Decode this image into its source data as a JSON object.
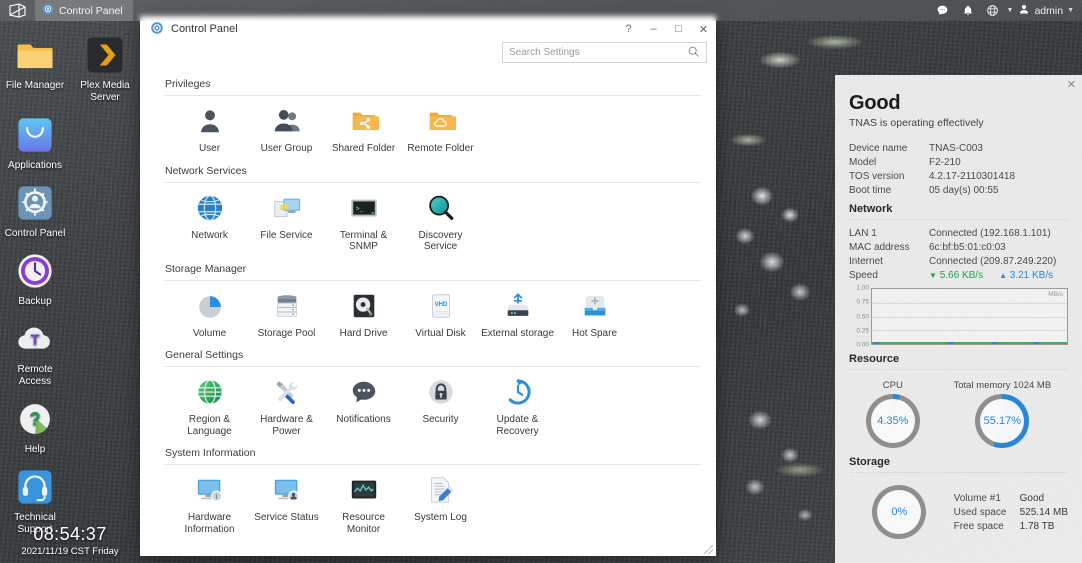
{
  "taskbar": {
    "home_icon": "tos-logo-icon",
    "task_label": "Control Panel",
    "task_icon": "control-panel-icon",
    "icons": [
      "chat-icon",
      "bell-icon",
      "globe-icon"
    ],
    "user_label": "admin",
    "user_icon": "user-icon"
  },
  "desktop": {
    "icons": [
      {
        "label": "File Manager",
        "icon": "folder-icon"
      },
      {
        "label": "Plex Media Server",
        "icon": "plex-icon"
      },
      {
        "label": "Applications",
        "icon": "app-store-icon"
      },
      {
        "label": "Control Panel",
        "icon": "control-panel-icon"
      },
      {
        "label": "Backup",
        "icon": "backup-clock-icon"
      },
      {
        "label": "Remote Access",
        "icon": "cloud-t-icon"
      },
      {
        "label": "Help",
        "icon": "question-mark-icon"
      },
      {
        "label": "Technical Support",
        "icon": "headset-icon"
      }
    ],
    "clock_time": "08:54:37",
    "clock_date": "2021/11/19 CST Friday"
  },
  "control_panel": {
    "title": "Control Panel",
    "title_icon": "control-panel-icon",
    "window_buttons": {
      "help": "?",
      "minimize": "–",
      "maximize": "□",
      "close": "✕"
    },
    "search_placeholder": "Search Settings",
    "search_value": "",
    "search_icon": "search-icon",
    "sections": [
      {
        "title": "Privileges",
        "items": [
          {
            "label": "User",
            "icon": "user-icon"
          },
          {
            "label": "User Group",
            "icon": "user-group-icon"
          },
          {
            "label": "Shared Folder",
            "icon": "shared-folder-icon"
          },
          {
            "label": "Remote Folder",
            "icon": "remote-folder-icon"
          }
        ]
      },
      {
        "title": "Network Services",
        "items": [
          {
            "label": "Network",
            "icon": "network-globe-icon"
          },
          {
            "label": "File Service",
            "icon": "file-service-icon"
          },
          {
            "label": "Terminal & SNMP",
            "icon": "terminal-icon"
          },
          {
            "label": "Discovery Service",
            "icon": "magnifier-icon"
          }
        ]
      },
      {
        "title": "Storage Manager",
        "items": [
          {
            "label": "Volume",
            "icon": "volume-pie-icon"
          },
          {
            "label": "Storage Pool",
            "icon": "storage-pool-icon"
          },
          {
            "label": "Hard Drive",
            "icon": "hard-drive-icon"
          },
          {
            "label": "Virtual Disk",
            "icon": "virtual-disk-icon"
          },
          {
            "label": "External storage",
            "icon": "external-storage-icon"
          },
          {
            "label": "Hot Spare",
            "icon": "hot-spare-icon"
          }
        ]
      },
      {
        "title": "General Settings",
        "items": [
          {
            "label": "Region & Language",
            "icon": "globe-grid-icon"
          },
          {
            "label": "Hardware & Power",
            "icon": "tools-icon"
          },
          {
            "label": "Notifications",
            "icon": "speech-bubble-icon"
          },
          {
            "label": "Security",
            "icon": "lock-icon"
          },
          {
            "label": "Update & Recovery",
            "icon": "update-clock-icon"
          }
        ]
      },
      {
        "title": "System Information",
        "items": [
          {
            "label": "Hardware Information",
            "icon": "monitor-info-icon"
          },
          {
            "label": "Service Status",
            "icon": "monitor-status-icon"
          },
          {
            "label": "Resource Monitor",
            "icon": "resource-monitor-icon"
          },
          {
            "label": "System Log",
            "icon": "system-log-icon"
          }
        ]
      }
    ]
  },
  "widget": {
    "close_icon": "close-icon",
    "status_title": "Good",
    "status_sub": "TNAS is operating effectively",
    "device_rows": [
      {
        "key": "Device name",
        "value": "TNAS-C003"
      },
      {
        "key": "Model",
        "value": "F2-210"
      },
      {
        "key": "TOS version",
        "value": "4.2.17-2110301418"
      },
      {
        "key": "Boot time",
        "value": "05 day(s) 00:55"
      }
    ],
    "network_head": "Network",
    "network_rows": [
      {
        "key": "LAN 1",
        "value": "Connected (192.168.1.101)"
      },
      {
        "key": "MAC address",
        "value": "6c:bf:b5:01:c0:03"
      },
      {
        "key": "Internet",
        "value": "Connected (209.87.249.220)"
      }
    ],
    "speed_key": "Speed",
    "speed_down": "5.66 KB/s",
    "speed_up": "3.21 KB/s",
    "chart": {
      "unit": "MB/s",
      "yticks": [
        "1.00",
        "0.75",
        "0.50",
        "0.25",
        "0.00"
      ]
    },
    "resource_head": "Resource",
    "cpu_label": "CPU",
    "cpu_value": "4.35%",
    "cpu_percent": 4.35,
    "mem_label": "Total memory 1024 MB",
    "mem_value": "55.17%",
    "mem_percent": 55.17,
    "storage_head": "Storage",
    "storage_value": "0%",
    "storage_percent": 0,
    "storage_rows": [
      {
        "key": "Volume #1",
        "value": "Good"
      },
      {
        "key": "Used space",
        "value": "525.14 MB"
      },
      {
        "key": "Free space",
        "value": "1.78 TB"
      }
    ],
    "accent_blue": "#2a86d8",
    "accent_green": "#19a84b",
    "ring_gray": "#8f8f8f"
  }
}
